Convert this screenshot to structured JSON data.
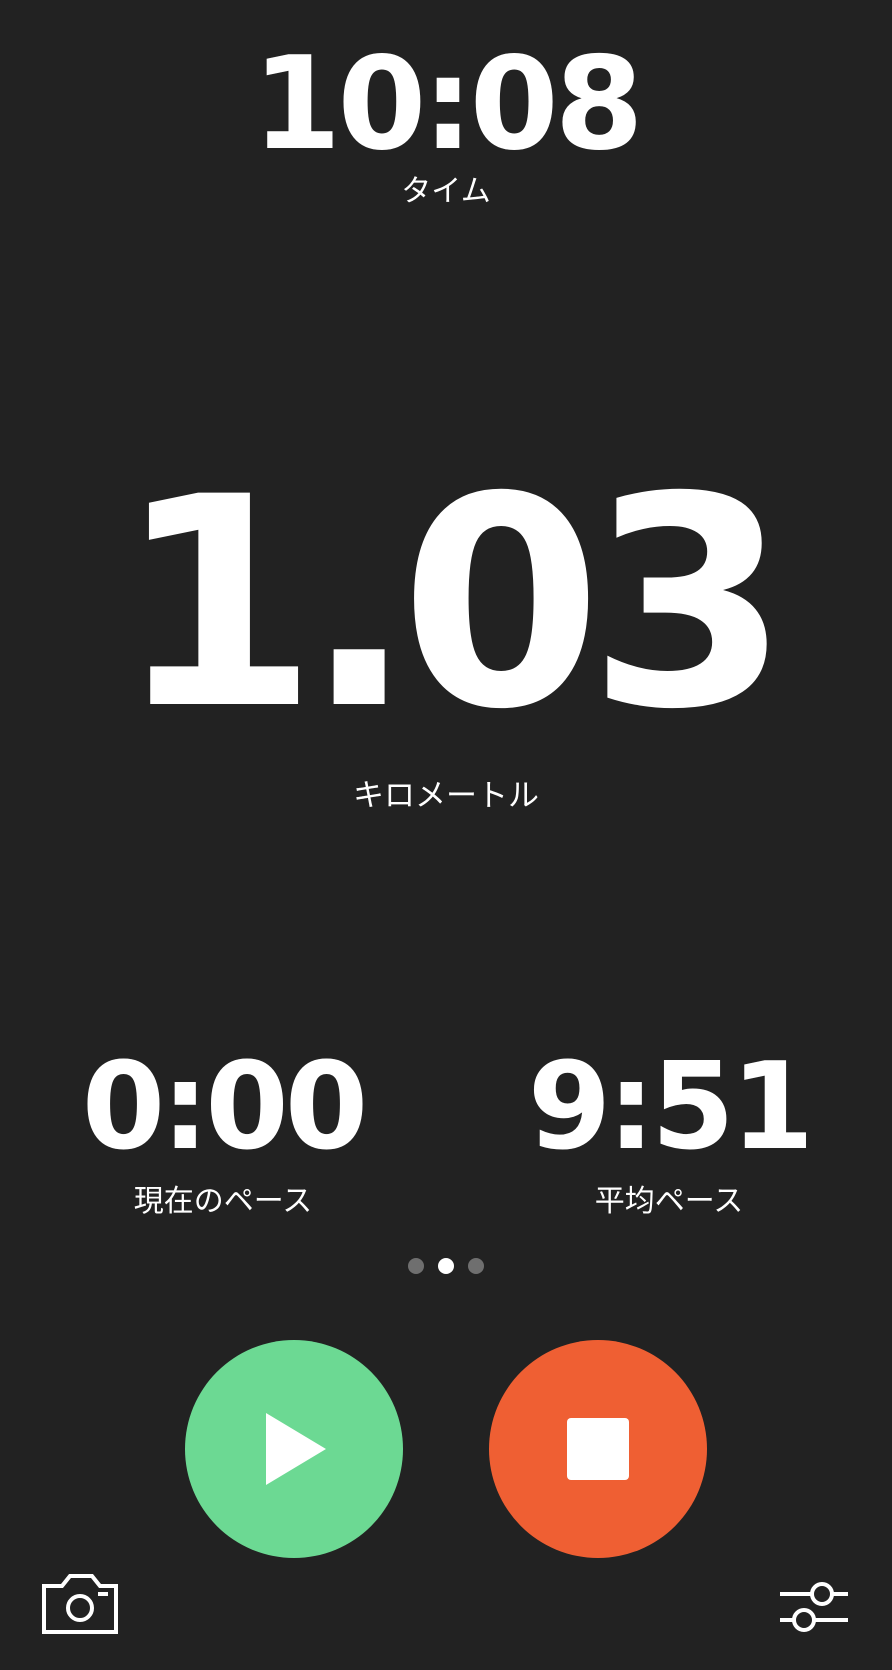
{
  "time": {
    "value": "10:08",
    "label": "タイム"
  },
  "distance": {
    "value": "1.03",
    "label": "キロメートル"
  },
  "stats": {
    "current_pace": {
      "value": "0:00",
      "label": "現在のペース"
    },
    "average_pace": {
      "value": "9:51",
      "label": "平均ペース"
    }
  },
  "pager": {
    "count": 3,
    "active_index": 1
  },
  "controls": {
    "play_icon": "play-icon",
    "stop_icon": "stop-icon",
    "camera_icon": "camera-icon",
    "settings_icon": "sliders-icon"
  },
  "colors": {
    "background": "#222222",
    "play": "#6cd993",
    "stop": "#ef5f33",
    "text": "#ffffff",
    "dot_inactive": "#6f6f6f"
  }
}
